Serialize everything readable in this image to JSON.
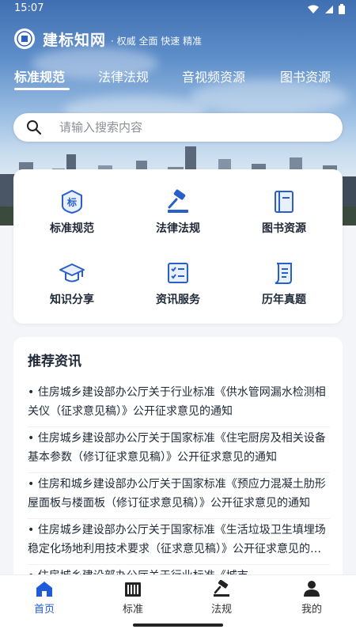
{
  "status_bar": {
    "time": "15:07"
  },
  "brand": {
    "name": "建标知网",
    "slogan": "· 权威 全面 快速 精准"
  },
  "tabs": [
    {
      "label": "标准规范",
      "active": true
    },
    {
      "label": "法律法规",
      "active": false
    },
    {
      "label": "音视频资源",
      "active": false
    },
    {
      "label": "图书资源",
      "active": false
    }
  ],
  "search": {
    "placeholder": "请输入搜索内容"
  },
  "grid": [
    {
      "label": "标准规范",
      "icon": "standard-badge-icon"
    },
    {
      "label": "法律法规",
      "icon": "gavel-icon"
    },
    {
      "label": "图书资源",
      "icon": "book-icon"
    },
    {
      "label": "知识分享",
      "icon": "graduation-cap-icon"
    },
    {
      "label": "资讯服务",
      "icon": "checklist-icon"
    },
    {
      "label": "历年真题",
      "icon": "scroll-icon"
    }
  ],
  "news": {
    "title": "推荐资讯",
    "items": [
      "• 住房城乡建设部办公厅关于行业标准《供水管网漏水检测相关仪（征求意见稿）》公开征求意见的通知",
      "• 住房城乡建设部办公厅关于国家标准《住宅厨房及相关设备基本参数（修订征求意见稿）》公开征求意见的通知",
      "• 住房和城乡建设部办公厅关于国家标准《预应力混凝土肋形屋面板与楼面板（修订征求意见稿）》公开征求意见的通知",
      "• 住房城乡建设部办公厅关于国家标准《生活垃圾卫生填埋场稳定化场地利用技术要求（征求意见稿）》公开征求意见的通知",
      "• 住房城乡建设部办公厅关于行业标准《城市"
    ]
  },
  "bottom_nav": [
    {
      "label": "首页",
      "icon": "home-icon",
      "active": true
    },
    {
      "label": "标准",
      "icon": "standard-book-icon",
      "active": false
    },
    {
      "label": "法规",
      "icon": "gavel-icon",
      "active": false
    },
    {
      "label": "我的",
      "icon": "user-icon",
      "active": false
    }
  ],
  "colors": {
    "accent": "#1e5bd8",
    "icon_blue": "#2a5fc9",
    "hero_top": "#3f6fb1"
  }
}
